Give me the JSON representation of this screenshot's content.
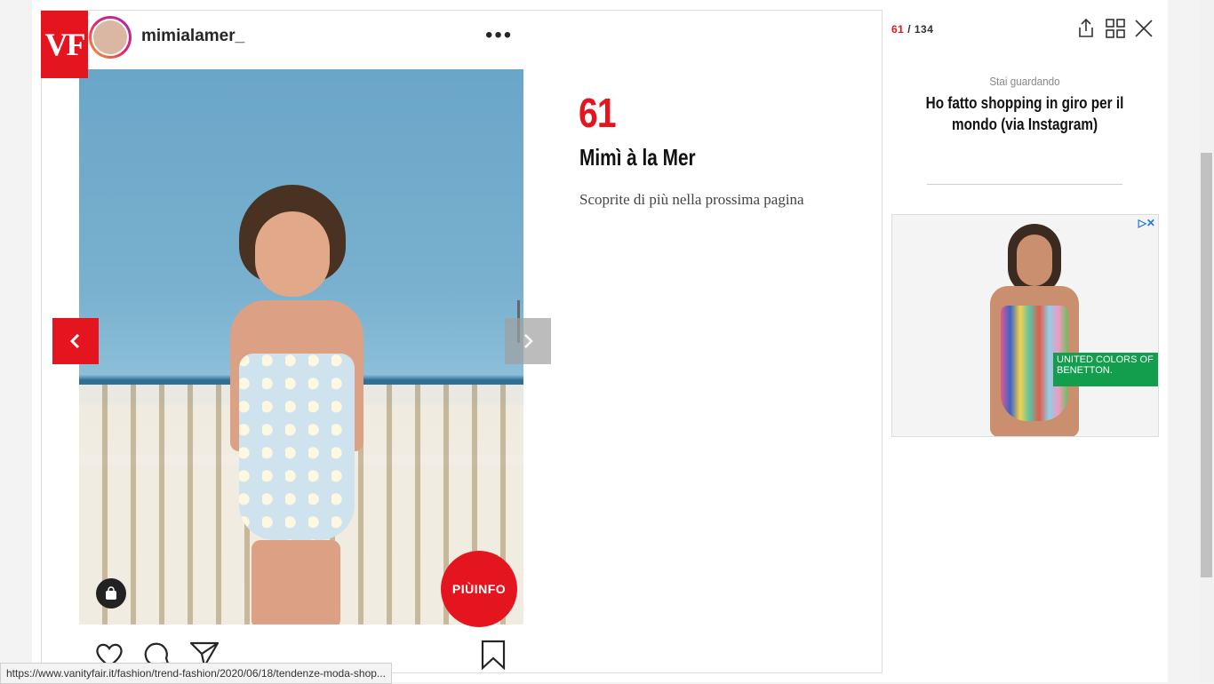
{
  "post": {
    "logo": "VF",
    "username": "mimialamer_",
    "more": "•••",
    "cta_label": "PIÙINFO"
  },
  "item": {
    "number": "61",
    "title": "Mimì à la Mer",
    "description": "Scoprite di più nella prossima pagina"
  },
  "gallery": {
    "current": "61",
    "separator": " / ",
    "total": "134",
    "watching_label": "Stai guardando",
    "watching_title": "Ho fatto shopping in giro per il mondo (via Instagram)"
  },
  "ad": {
    "brand": "UNITED COLORS OF BENETTON.",
    "badge": "▷✕"
  },
  "status_bar": {
    "url": "https://www.vanityfair.it/fashion/trend-fashion/2020/06/18/tendenze-moda-shop..."
  },
  "colors": {
    "accent": "#e4151f",
    "ad_green": "#129e4c"
  }
}
